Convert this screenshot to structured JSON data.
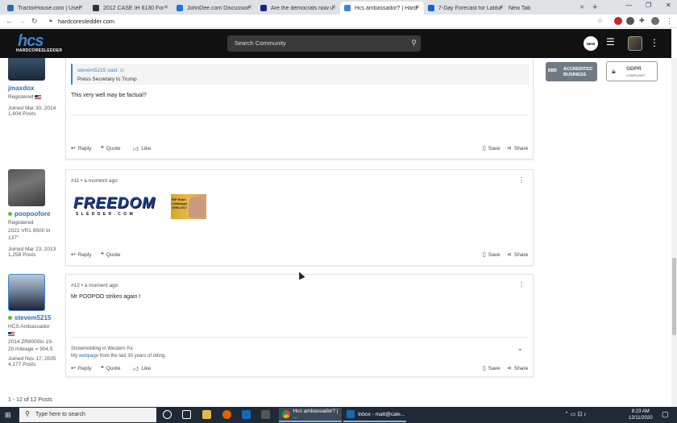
{
  "browser": {
    "tabs": [
      {
        "label": "TractorHouse.com | Used T",
        "color": "#2b6cb0"
      },
      {
        "label": "2012 CASE IH 6130 For Sal",
        "color": "#333"
      },
      {
        "label": "JohnDee.com Discussion B",
        "color": "#1a73e8"
      },
      {
        "label": "Are the democrats now us",
        "color": "#1a237e"
      },
      {
        "label": "Hcs ambassador? | Hardco",
        "color": "#3a86d1"
      },
      {
        "label": "7-Day Forecast for Latitud",
        "color": "#1565c0"
      },
      {
        "label": "New Tab",
        "color": "#bbb"
      }
    ],
    "new_tab": "+",
    "minimize": "—",
    "maximize": "❐",
    "close": "✕",
    "url": "hardcoresledder.com"
  },
  "site": {
    "logo_main": "hcs",
    "logo_sub": "HARDCORESLEDDER",
    "search_placeholder": "Search Community",
    "new_badge": "NEW"
  },
  "posts": [
    {
      "author": "jmaxdox",
      "role": "Registered",
      "joined": "Joined Mar 30, 2014",
      "posts": "1,604 Posts",
      "quote_author": "stevem5215 said:",
      "quote_text": "Press Secretary to Trump",
      "body": "This very well may be factual?",
      "actions": {
        "reply": "Reply",
        "quote": "Quote",
        "like": "Like",
        "save": "Save",
        "share": "Share"
      }
    },
    {
      "number": "#11",
      "time": "a moment ago",
      "author": "poopoofore",
      "role": "Registered",
      "sled": "2021 VR1 850II In 137\"",
      "joined": "Joined Mar 23, 2013",
      "posts": "1,258 Posts",
      "sig_banner": "FREEDOM",
      "sig_banner_sub": "S L E D D E R . C O M",
      "sig_img_caption": "RIP Rush Limbaugh 1998-2017",
      "actions": {
        "reply": "Reply",
        "quote": "Quote",
        "save": "Save",
        "share": "Share"
      }
    },
    {
      "number": "#12",
      "time": "a moment ago",
      "author": "stevem5215",
      "role": "HCS Ambassador",
      "sled": "2014 ZR8000kr 19-20 mileage = 904.5",
      "joined": "Joined Nov 17, 2005",
      "posts": "4,177 Posts",
      "body": "Mr POOPOO strikes again !",
      "sig_line1": "Snowmobiling in Western Pa",
      "sig_line2_pre": "My ",
      "sig_link": "webpage",
      "sig_line2_post": " from the last 30 years of riding.",
      "actions": {
        "reply": "Reply",
        "quote": "Quote",
        "like": "Like",
        "save": "Save",
        "share": "Share"
      }
    }
  ],
  "sidebar": {
    "bbb_line1": "ACCREDITED",
    "bbb_line2": "BUSINESS",
    "bbb_short": "BBB",
    "gdpr": "GDPR",
    "gdpr_sub": "COMPLIANT"
  },
  "pagination": "1 - 12 of 12 Posts",
  "taskbar": {
    "search_placeholder": "Type here to search",
    "chrome_label": "Hcs ambassador? | ...",
    "outlook_label": "Inbox - matt@cale...",
    "time": "8:23 AM",
    "date": "12/11/2020"
  }
}
